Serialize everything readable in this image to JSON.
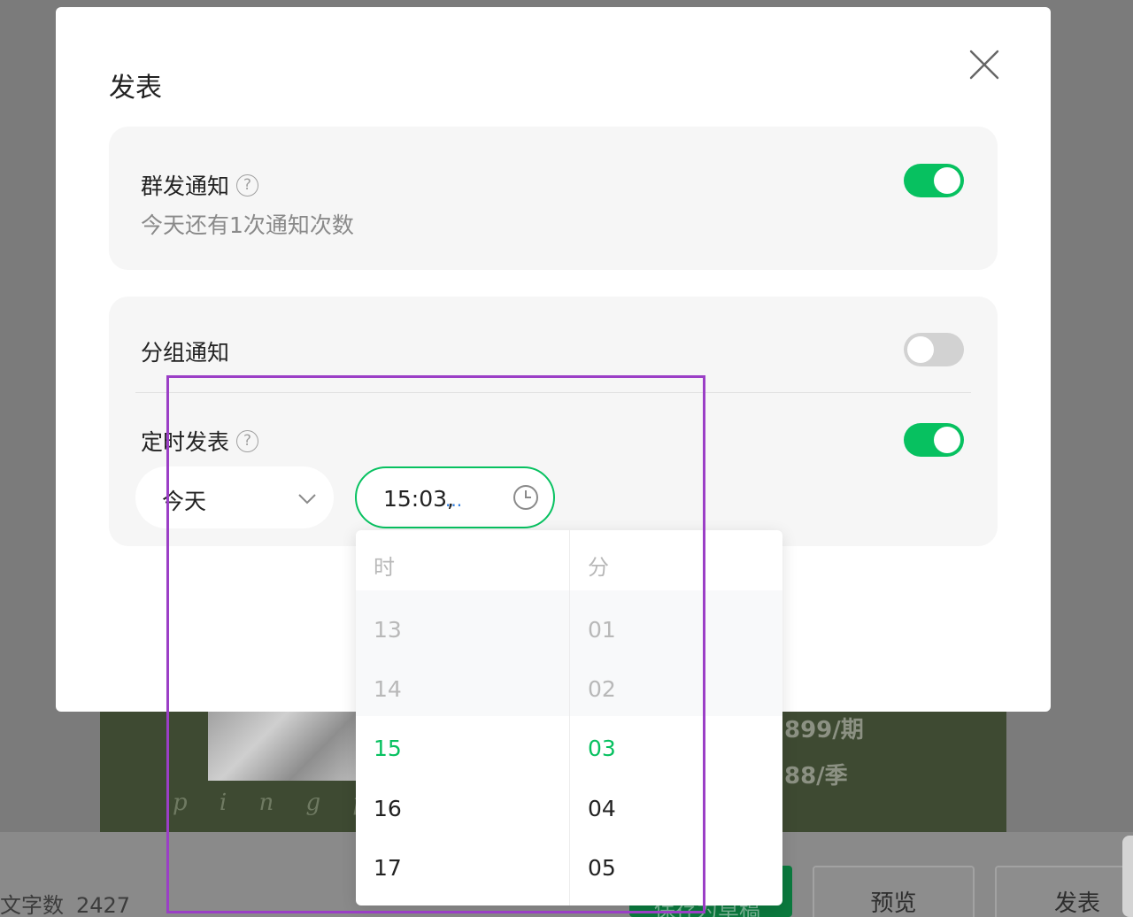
{
  "modal": {
    "title": "发表",
    "close_icon": "close-icon"
  },
  "mass_notify": {
    "label": "群发通知",
    "help": "?",
    "subtext": "今天还有1次通知次数",
    "enabled": true
  },
  "group_notify": {
    "label": "分组通知",
    "enabled": false
  },
  "scheduled": {
    "label": "定时发表",
    "help": "?",
    "enabled": true,
    "date_value": "今天",
    "time_value": "15:03",
    "time_suffix": ",",
    "time_dots": "...",
    "clock_icon": "clock-icon"
  },
  "time_picker": {
    "hour_header": "时",
    "minute_header": "分",
    "hours": [
      "13",
      "14",
      "15",
      "16",
      "17"
    ],
    "minutes": [
      "01",
      "02",
      "03",
      "04",
      "05"
    ],
    "selected_hour": "15",
    "selected_minute": "03"
  },
  "background": {
    "price_1": "899/期",
    "price_2": "88/季",
    "script_text": "p i n g   p",
    "word_count_label": "文字数",
    "word_count_value": "2427",
    "save_label": "保存为草稿",
    "preview_label": "预览",
    "publish_label": "发表"
  },
  "colors": {
    "accent": "#07c160",
    "annotation": "#9b3fc6"
  }
}
